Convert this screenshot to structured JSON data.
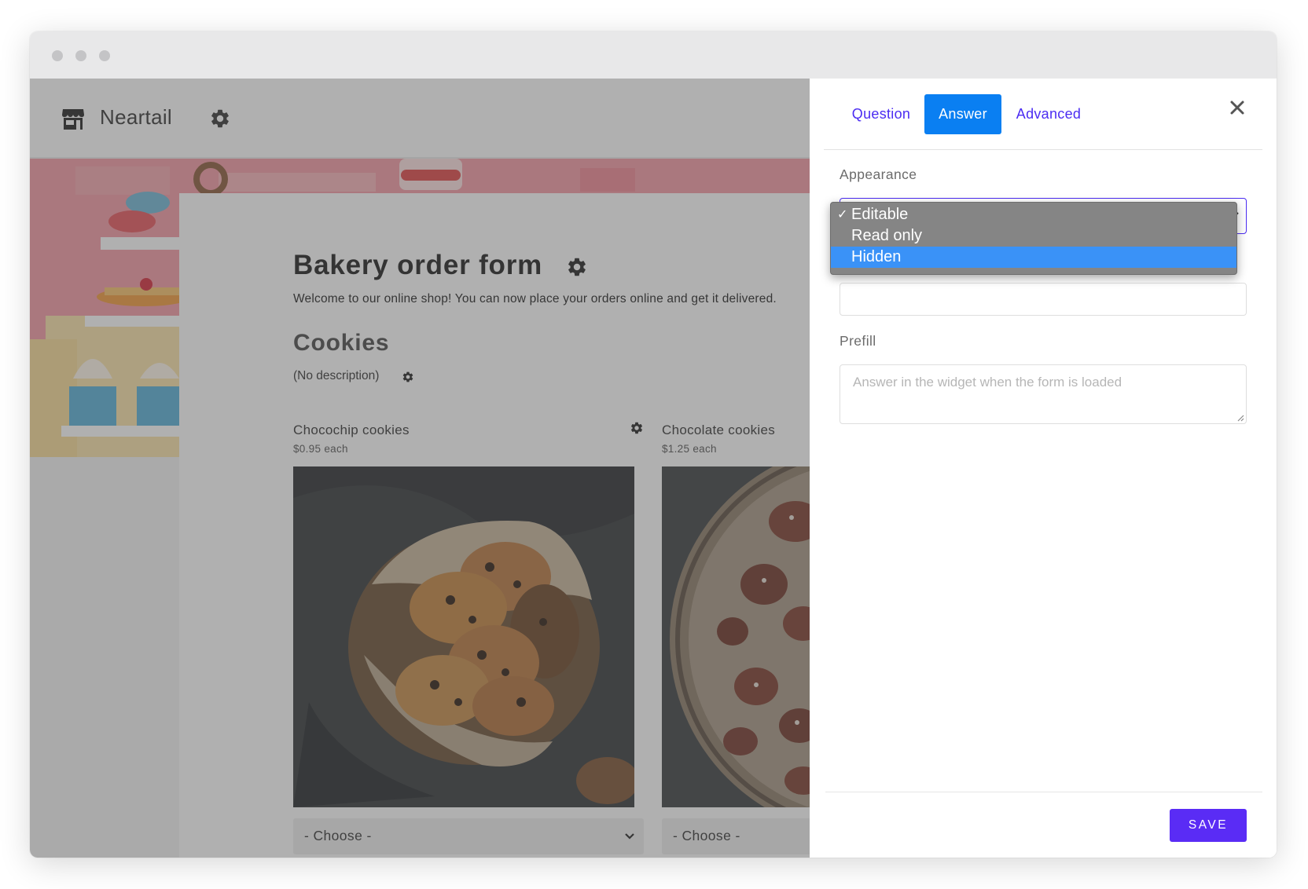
{
  "app": {
    "brand_name": "Neartail"
  },
  "form": {
    "title": "Bakery order form",
    "description": "Welcome to our online shop! You can now place your orders online and get it delivered.",
    "section": {
      "title": "Cookies",
      "description": "(No description)"
    },
    "products": [
      {
        "name": "Chocochip cookies",
        "price": "$0.95 each",
        "select_value": "- Choose -"
      },
      {
        "name": "Chocolate cookies",
        "price": "$1.25 each",
        "select_value": "- Choose -"
      }
    ]
  },
  "panel": {
    "tabs": [
      {
        "label": "Question",
        "active": false
      },
      {
        "label": "Answer",
        "active": true
      },
      {
        "label": "Advanced",
        "active": false
      }
    ],
    "appearance_label": "Appearance",
    "appearance_options": [
      {
        "label": "Editable",
        "checked": true,
        "highlighted": false
      },
      {
        "label": "Read only",
        "checked": false,
        "highlighted": false
      },
      {
        "label": "Hidden",
        "checked": false,
        "highlighted": true
      }
    ],
    "check_mark": "✓",
    "prefill_label": "Prefill",
    "prefill_placeholder": "Answer in the widget when the form is loaded",
    "save_label": "SAVE"
  },
  "colors": {
    "accent": "#4b2cf2",
    "active_tab": "#0a7ff2",
    "save_button": "#5a2cf5",
    "banner_pink": "#f49aa4",
    "dropdown_bg": "#858585",
    "dropdown_highlight": "#3a92f7"
  },
  "icons": [
    "store-icon",
    "gear-icon",
    "close-icon",
    "chevron-down-icon",
    "check-icon",
    "resize-handle-icon"
  ]
}
